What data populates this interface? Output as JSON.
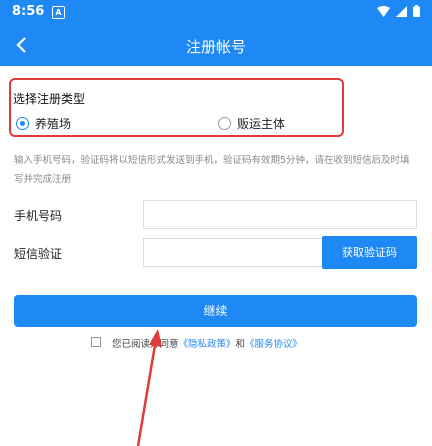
{
  "status_bar": {
    "time": "8:56",
    "notification_glyph": "A"
  },
  "header": {
    "title": "注册帐号"
  },
  "register_type": {
    "title": "选择注册类型",
    "options": [
      {
        "label": "养殖场",
        "selected": true
      },
      {
        "label": "贩运主体",
        "selected": false
      }
    ]
  },
  "hint": "输入手机号码，验证码将以短信形式发送到手机，验证码有效期5分钟，请在收到短信后及时填写并完成注册",
  "form": {
    "phone_label": "手机号码",
    "phone_value": "",
    "sms_label": "短信验证",
    "sms_value": "",
    "get_code_label": "获取验证码"
  },
  "submit_label": "继续",
  "agreement": {
    "prefix": "您已阅读并同意",
    "privacy": "《隐私政策》",
    "and": "和",
    "service": "《服务协议》"
  },
  "colors": {
    "accent": "#1e88f5",
    "highlight": "#e03a3a"
  }
}
